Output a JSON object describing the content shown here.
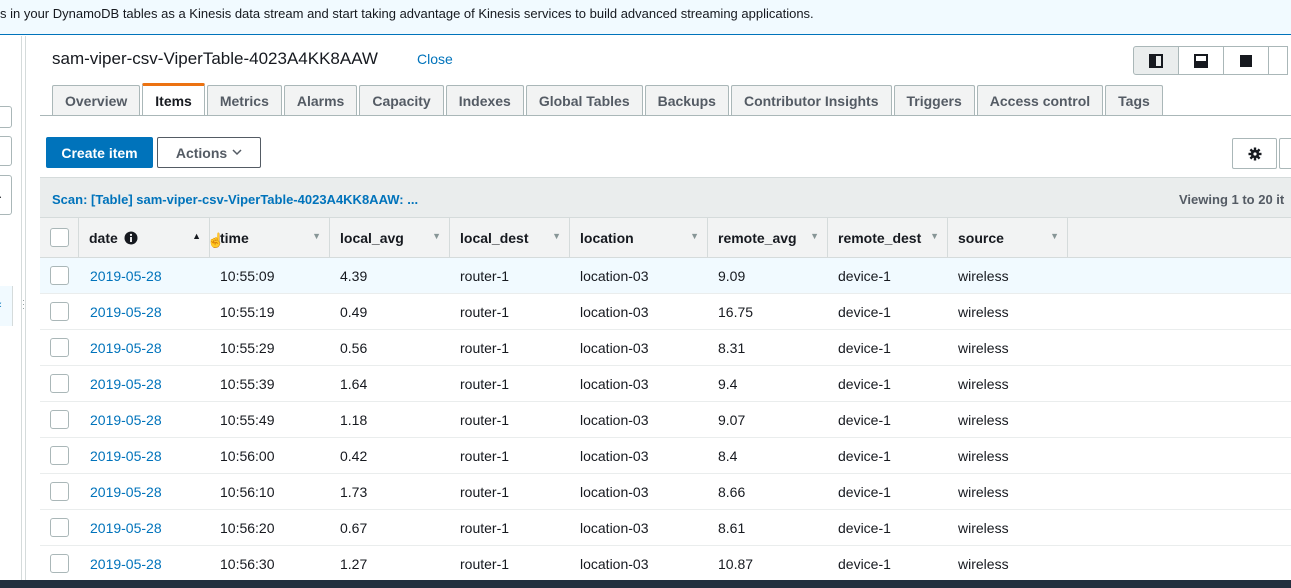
{
  "banner": {
    "text": "s in your DynamoDB tables as a Kinesis data stream and start taking advantage of Kinesis services to build advanced streaming applications."
  },
  "header": {
    "title": "sam-viper-csv-ViperTable-4023A4KK8AAW",
    "close_label": "Close"
  },
  "tabs": [
    {
      "label": "Overview"
    },
    {
      "label": "Items"
    },
    {
      "label": "Metrics"
    },
    {
      "label": "Alarms"
    },
    {
      "label": "Capacity"
    },
    {
      "label": "Indexes"
    },
    {
      "label": "Global Tables"
    },
    {
      "label": "Backups"
    },
    {
      "label": "Contributor Insights"
    },
    {
      "label": "Triggers"
    },
    {
      "label": "Access control"
    },
    {
      "label": "Tags"
    }
  ],
  "active_tab": "Items",
  "toolbar": {
    "create_label": "Create item",
    "actions_label": "Actions"
  },
  "scan": {
    "label": "Scan: [Table] sam-viper-csv-ViperTable-4023A4KK8AAW: ...",
    "viewing": "Viewing 1 to 20 it"
  },
  "table": {
    "columns": [
      "date",
      "time",
      "local_avg",
      "local_dest",
      "location",
      "remote_avg",
      "remote_dest",
      "source"
    ],
    "rows": [
      [
        "2019-05-28",
        "10:55:09",
        "4.39",
        "router-1",
        "location-03",
        "9.09",
        "device-1",
        "wireless"
      ],
      [
        "2019-05-28",
        "10:55:19",
        "0.49",
        "router-1",
        "location-03",
        "16.75",
        "device-1",
        "wireless"
      ],
      [
        "2019-05-28",
        "10:55:29",
        "0.56",
        "router-1",
        "location-03",
        "8.31",
        "device-1",
        "wireless"
      ],
      [
        "2019-05-28",
        "10:55:39",
        "1.64",
        "router-1",
        "location-03",
        "9.4",
        "device-1",
        "wireless"
      ],
      [
        "2019-05-28",
        "10:55:49",
        "1.18",
        "router-1",
        "location-03",
        "9.07",
        "device-1",
        "wireless"
      ],
      [
        "2019-05-28",
        "10:56:00",
        "0.42",
        "router-1",
        "location-03",
        "8.4",
        "device-1",
        "wireless"
      ],
      [
        "2019-05-28",
        "10:56:10",
        "1.73",
        "router-1",
        "location-03",
        "8.66",
        "device-1",
        "wireless"
      ],
      [
        "2019-05-28",
        "10:56:20",
        "0.67",
        "router-1",
        "location-03",
        "8.61",
        "device-1",
        "wireless"
      ],
      [
        "2019-05-28",
        "10:56:30",
        "1.27",
        "router-1",
        "location-03",
        "10.87",
        "device-1",
        "wireless"
      ]
    ]
  },
  "colors": {
    "link": "#0073bb",
    "primary": "#0073bb",
    "tab_accent": "#ec7211",
    "selected_row": "#f1faff"
  },
  "icons": {
    "info": "info-icon",
    "sort": "sort-icon",
    "gear": "gear-icon",
    "caret": "chevron-down-icon",
    "cursor": "hand-pointer-icon"
  }
}
